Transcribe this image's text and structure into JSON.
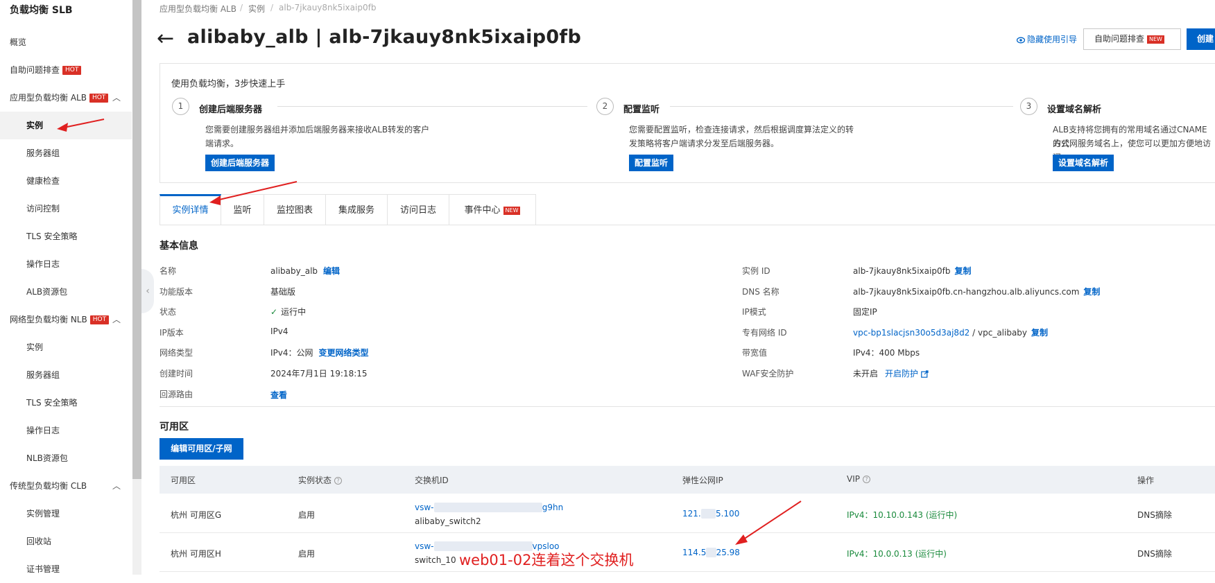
{
  "sidebar": {
    "title": "负载均衡 SLB",
    "hot_badge": "HOT",
    "items": [
      {
        "label": "概览",
        "level": 1
      },
      {
        "label": "自助问题排查",
        "level": 1,
        "badge": "HOT"
      },
      {
        "label": "应用型负载均衡 ALB",
        "level": 1,
        "badge": "HOT",
        "expanded": true
      },
      {
        "label": "实例",
        "level": 2,
        "active": true
      },
      {
        "label": "服务器组",
        "level": 2
      },
      {
        "label": "健康检查",
        "level": 2
      },
      {
        "label": "访问控制",
        "level": 2
      },
      {
        "label": "TLS 安全策略",
        "level": 2
      },
      {
        "label": "操作日志",
        "level": 2
      },
      {
        "label": "ALB资源包",
        "level": 2
      },
      {
        "label": "网络型负载均衡 NLB",
        "level": 1,
        "badge": "HOT",
        "expanded": true
      },
      {
        "label": "实例",
        "level": 2
      },
      {
        "label": "服务器组",
        "level": 2
      },
      {
        "label": "TLS 安全策略",
        "level": 2
      },
      {
        "label": "操作日志",
        "level": 2
      },
      {
        "label": "NLB资源包",
        "level": 2
      },
      {
        "label": "传统型负载均衡 CLB",
        "level": 1,
        "expanded": true
      },
      {
        "label": "实例管理",
        "level": 2
      },
      {
        "label": "回收站",
        "level": 2
      },
      {
        "label": "证书管理",
        "level": 2
      }
    ]
  },
  "breadcrumb": [
    "应用型负载均衡 ALB",
    "实例",
    "alb-7jkauy8nk5ixaip0fb"
  ],
  "breadcrumb_sep": "/",
  "header": {
    "back_icon": "←",
    "title": "alibaby_alb | alb-7jkauy8nk5ixaip0fb",
    "guide_icon": "eye-icon",
    "guide_link": "隐藏使用引导",
    "self_check_btn": "自助问题排查",
    "new_badge": "NEW",
    "create_btn": "创建"
  },
  "quick_start": {
    "title": "使用负载均衡，3步快速上手",
    "steps": [
      {
        "num": "1",
        "title": "创建后端服务器",
        "desc1": "您需要创建服务器组并添加后端服务器来接收ALB转发的客户",
        "desc2": "端请求。",
        "button": "创建后端服务器"
      },
      {
        "num": "2",
        "title": "配置监听",
        "desc1": "您需要配置监听，检查连接请求，然后根据调度算法定义的转",
        "desc2": "发策略将客户端请求分发至后端服务器。",
        "button": "配置监听"
      },
      {
        "num": "3",
        "title": "设置域名解析",
        "desc1": "ALB支持将您拥有的常用域名通过CNAME方式",
        "desc2": "的公网服务域名上，使您可以更加方便地访问",
        "button": "设置域名解析"
      }
    ]
  },
  "tabs": [
    {
      "label": "实例详情",
      "active": true
    },
    {
      "label": "监听"
    },
    {
      "label": "监控图表"
    },
    {
      "label": "集成服务"
    },
    {
      "label": "访问日志"
    },
    {
      "label": "事件中心",
      "badge": "NEW"
    }
  ],
  "basic_info": {
    "title": "基本信息",
    "left": [
      {
        "label": "名称",
        "value": "alibaby_alb",
        "action": "编辑"
      },
      {
        "label": "功能版本",
        "value": "基础版"
      },
      {
        "label": "状态",
        "value": "运行中",
        "icon": "check-icon"
      },
      {
        "label": "IP版本",
        "value": "IPv4"
      },
      {
        "label": "网络类型",
        "value": "IPv4：公网",
        "action": "变更网络类型"
      },
      {
        "label": "创建时间",
        "value": "2024年7月1日 19:18:15"
      },
      {
        "label": "回源路由",
        "value": "",
        "action": "查看"
      }
    ],
    "right": [
      {
        "label": "实例 ID",
        "value": "alb-7jkauy8nk5ixaip0fb",
        "action": "复制"
      },
      {
        "label": "DNS 名称",
        "value": "alb-7jkauy8nk5ixaip0fb.cn-hangzhou.alb.aliyuncs.com",
        "action": "复制"
      },
      {
        "label": "IP模式",
        "value": "固定IP"
      },
      {
        "label": "专有网络 ID",
        "value_link": "vpc-bp1slacjsn30o5d3aj8d2",
        "value_sep": " / ",
        "value": "vpc_alibaby",
        "action": "复制"
      },
      {
        "label": "带宽值",
        "value": "IPv4：400 Mbps"
      },
      {
        "label": "WAF安全防护",
        "value": "未开启",
        "action": "开启防护",
        "action_icon": "external-link-icon"
      }
    ]
  },
  "zones": {
    "title": "可用区",
    "edit_btn": "编辑可用区/子网",
    "columns": [
      "可用区",
      "实例状态",
      "交换机ID",
      "弹性公网IP",
      "VIP",
      "操作"
    ],
    "rows": [
      {
        "zone": "杭州 可用区G",
        "status": "启用",
        "vsw_start": "vsw-",
        "vsw_end": "g9hn",
        "vsw_name": "alibaby_switch2",
        "eip_start": "121.",
        "eip_end": "5.100",
        "vip": "IPv4：10.10.0.143 (运行中)",
        "op": "DNS摘除"
      },
      {
        "zone": "杭州 可用区H",
        "status": "启用",
        "vsw_start": "vsw-",
        "vsw_end": "vpsloo",
        "vsw_name": "switch_10",
        "eip_start": "114.5",
        "eip_end": "25.98",
        "vip": "IPv4：10.0.0.13 (运行中)",
        "op": "DNS摘除"
      }
    ]
  },
  "annotation": {
    "text": "web01-02连着这个交换机",
    "color": "#e02020"
  },
  "colors": {
    "accent": "#0064c8",
    "hot": "#d93026",
    "success": "#1a8a3c"
  }
}
